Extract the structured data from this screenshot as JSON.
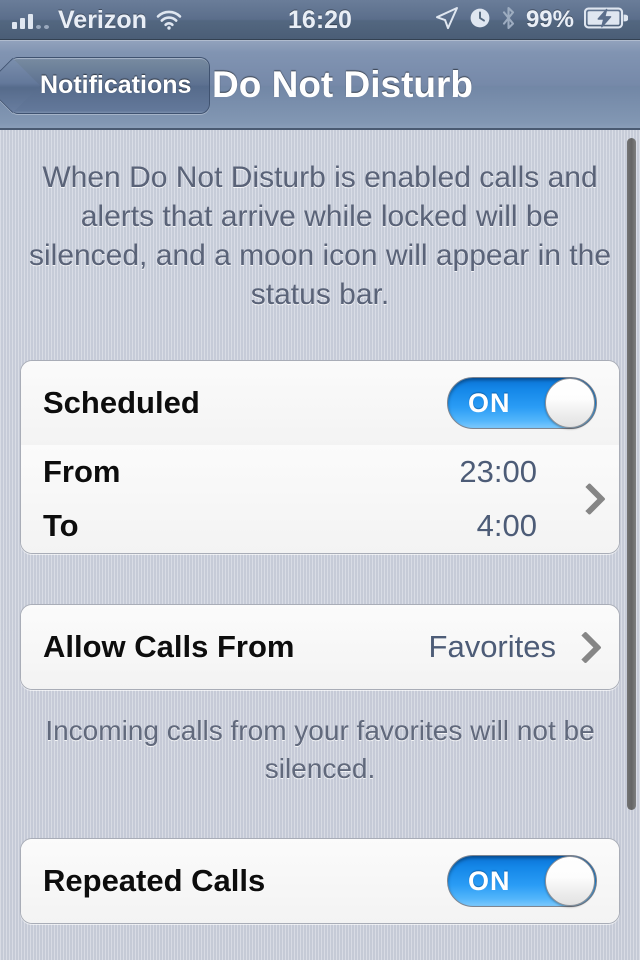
{
  "status_bar": {
    "carrier": "Verizon",
    "time": "16:20",
    "battery_percent": "99%",
    "signal_icon": "signal-bars-icon",
    "wifi_icon": "wifi-icon",
    "location_icon": "location-arrow-icon",
    "alarm_icon": "alarm-clock-icon",
    "bluetooth_icon": "bluetooth-icon",
    "battery_icon": "battery-charging-icon"
  },
  "nav_bar": {
    "back_label": "Notifications",
    "title": "Do Not Disturb"
  },
  "intro": {
    "text": "When Do Not Disturb is enabled calls and alerts that arrive while locked will be silenced, and a moon icon will appear in the status bar."
  },
  "scheduled": {
    "label": "Scheduled",
    "toggle_state": "ON",
    "from_label": "From",
    "from_value": "23:00",
    "to_label": "To",
    "to_value": "4:00"
  },
  "allow_calls": {
    "label": "Allow Calls From",
    "value": "Favorites",
    "footer": "Incoming calls from your favorites will not be silenced."
  },
  "repeated_calls": {
    "label": "Repeated Calls",
    "toggle_state": "ON"
  },
  "colors": {
    "accent_blue": "#1487e8",
    "value_text": "#4d5c77",
    "nav_bar": "#7689a9",
    "page_background": "#c8cdda"
  }
}
